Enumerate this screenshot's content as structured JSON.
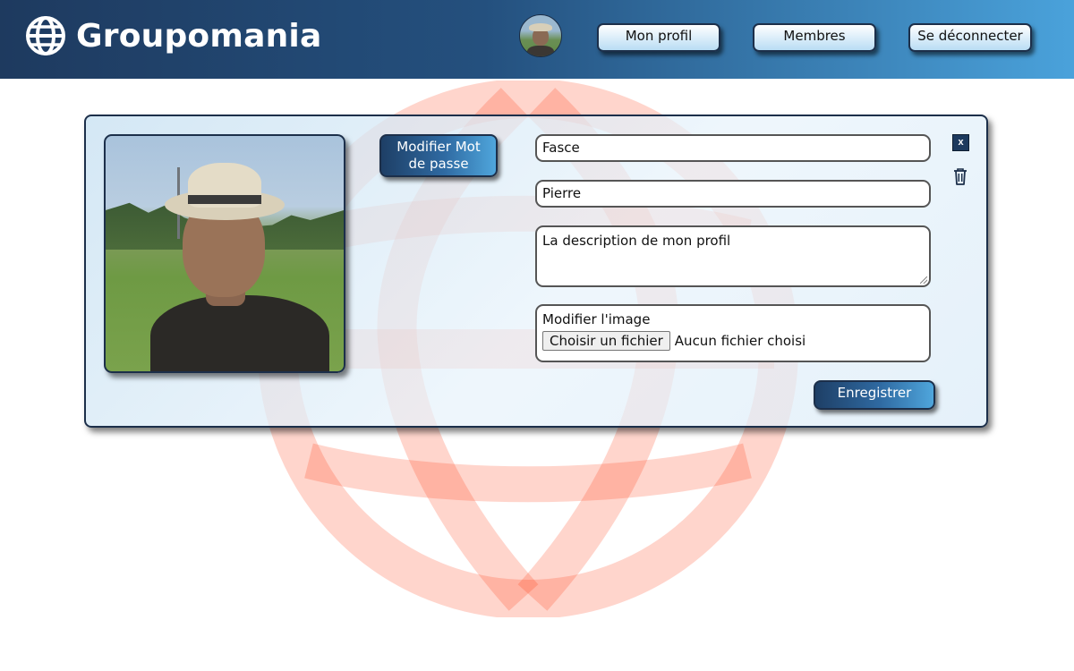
{
  "header": {
    "brand_name": "Groupomania",
    "brand_icon": "globe-icon",
    "nav": {
      "profile_label": "Mon profil",
      "members_label": "Membres",
      "logout_label": "Se déconnecter"
    }
  },
  "profile": {
    "change_password_label": "Modifier Mot de passe",
    "last_name": "Fasce",
    "first_name": "Pierre",
    "description": "La description de mon profil",
    "image_label": "Modifier l'image",
    "file_button_label": "Choisir un fichier",
    "file_status": "Aucun fichier choisi",
    "save_label": "Enregistrer",
    "close_label": "x",
    "delete_icon": "trash-icon"
  },
  "colors": {
    "header_start": "#1e3a5f",
    "header_end": "#4aa2db",
    "watermark": "#fd2d01",
    "button_dark": "#1e3f66"
  }
}
